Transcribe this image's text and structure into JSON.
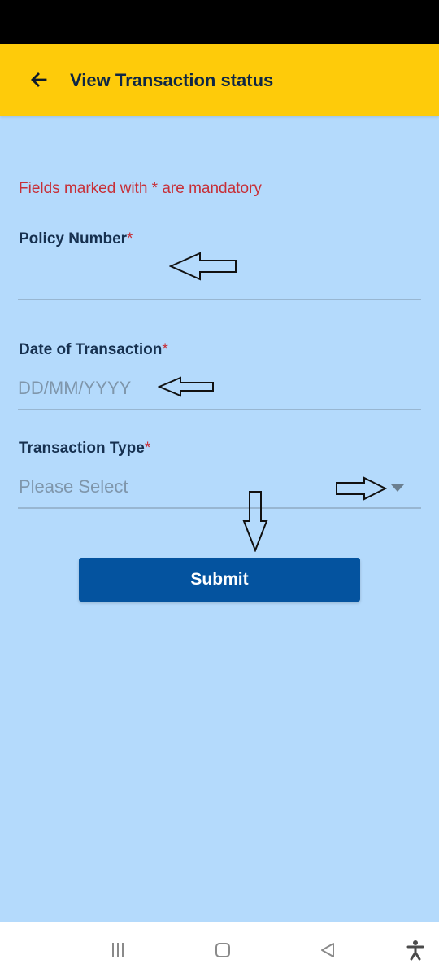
{
  "app_bar": {
    "title": "View Transaction status",
    "background_color": "#fecb0a",
    "back_icon": "arrow-left-icon"
  },
  "form": {
    "mandatory_note": "Fields marked with * are mandatory",
    "required_marker": "*",
    "policy_number": {
      "label": "Policy Number",
      "value": "",
      "placeholder": ""
    },
    "date_of_transaction": {
      "label": "Date of Transaction",
      "value": "",
      "placeholder": "DD/MM/YYYY"
    },
    "transaction_type": {
      "label": "Transaction Type",
      "selected": "Please Select",
      "icon": "dropdown-caret-icon"
    },
    "submit_label": "Submit"
  },
  "annotations": {
    "icon": "hollow-arrow-icon",
    "count": 4
  },
  "system_nav": {
    "icons": [
      "recent-apps-icon",
      "home-icon",
      "back-triangle-icon",
      "accessibility-icon"
    ]
  },
  "colors": {
    "page_background": "#b4dafc",
    "accent_required": "#c72f37",
    "submit_button": "#04539f",
    "label_text": "#16304f"
  }
}
